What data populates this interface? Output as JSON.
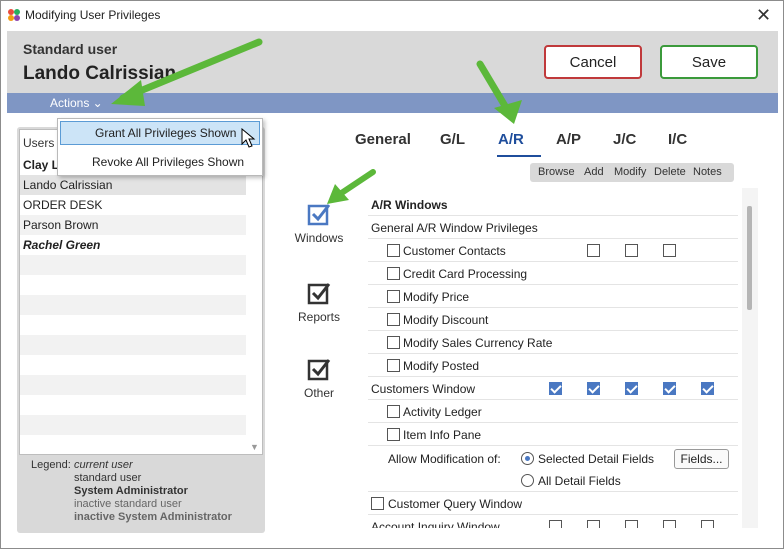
{
  "window": {
    "title": "Modifying User Privileges",
    "close": "✕"
  },
  "header": {
    "user_type": "Standard user",
    "user_name": "Lando Calrissian"
  },
  "buttons": {
    "cancel": "Cancel",
    "save": "Save"
  },
  "actions": {
    "label": "Actions ⌄"
  },
  "menu": {
    "items": [
      "Grant All Privileges Shown",
      "Revoke All Privileges Shown"
    ]
  },
  "users": {
    "header": "Users",
    "rows": [
      "Clay Lo",
      "Lando Calrissian",
      "ORDER DESK",
      "Parson Brown",
      "Rachel Green"
    ]
  },
  "legend": {
    "label": "Legend:",
    "items": [
      "current user",
      "standard user",
      "System Administrator",
      "inactive standard user",
      "inactive System Administrator"
    ]
  },
  "tabs": [
    "General",
    "G/L",
    "A/R",
    "A/P",
    "J/C",
    "I/C"
  ],
  "active_tab": "A/R",
  "columns": [
    "Browse",
    "Add",
    "Modify",
    "Delete",
    "Notes"
  ],
  "categories": [
    "Windows",
    "Reports",
    "Other"
  ],
  "section": {
    "title": "A/R Windows",
    "general": "General A/R Window Privileges",
    "items": [
      {
        "label": "Customer Contacts",
        "checked": false
      },
      {
        "label": "Credit Card Processing",
        "checked": false
      },
      {
        "label": "Modify Price",
        "checked": false
      },
      {
        "label": "Modify Discount",
        "checked": false
      },
      {
        "label": "Modify Sales Currency Rate",
        "checked": false
      },
      {
        "label": "Modify Posted",
        "checked": false
      }
    ],
    "customers_window": "Customers Window",
    "customers_items": [
      {
        "label": "Activity Ledger",
        "checked": false
      },
      {
        "label": "Item Info Pane",
        "checked": false
      }
    ],
    "allow_mod": "Allow Modification of:",
    "radio_selected": "Selected Detail Fields",
    "radio_all": "All Detail Fields",
    "fields_button": "Fields...",
    "customer_query": "Customer Query Window",
    "account_inquiry": "Account Inquiry Window"
  },
  "colors": {
    "accent": "#1f4e9c",
    "actions_bar": "#7f96c4",
    "check": "#4a78c2",
    "arrow": "#5cb83a"
  }
}
